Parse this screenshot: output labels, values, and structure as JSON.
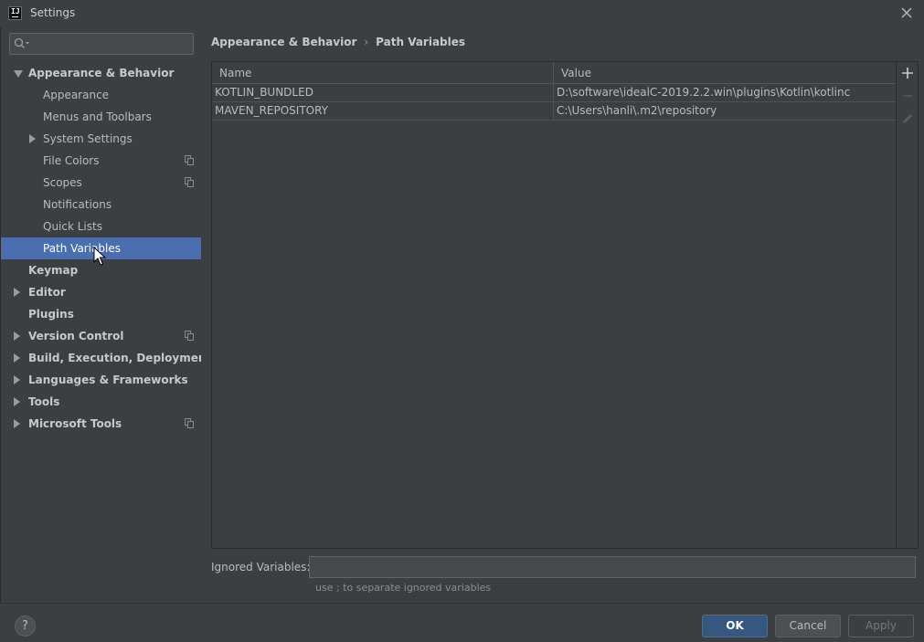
{
  "window": {
    "title": "Settings",
    "app_icon_text": "IJ"
  },
  "sidebar": {
    "search_placeholder": "",
    "items": [
      {
        "label": "Appearance & Behavior",
        "bold": true,
        "arrow": "down"
      },
      {
        "label": "Appearance"
      },
      {
        "label": "Menus and Toolbars"
      },
      {
        "label": "System Settings",
        "arrow": "right"
      },
      {
        "label": "File Colors",
        "project_icon": true
      },
      {
        "label": "Scopes",
        "project_icon": true
      },
      {
        "label": "Notifications"
      },
      {
        "label": "Quick Lists"
      },
      {
        "label": "Path Variables",
        "selected": true
      },
      {
        "label": "Keymap",
        "bold": true
      },
      {
        "label": "Editor",
        "bold": true,
        "arrow": "right"
      },
      {
        "label": "Plugins",
        "bold": true
      },
      {
        "label": "Version Control",
        "bold": true,
        "arrow": "right",
        "project_icon": true
      },
      {
        "label": "Build, Execution, Deployment",
        "bold": true,
        "arrow": "right"
      },
      {
        "label": "Languages & Frameworks",
        "bold": true,
        "arrow": "right"
      },
      {
        "label": "Tools",
        "bold": true,
        "arrow": "right"
      },
      {
        "label": "Microsoft Tools",
        "bold": true,
        "arrow": "right",
        "project_icon": true
      }
    ]
  },
  "breadcrumb": {
    "parent": "Appearance & Behavior",
    "separator": "›",
    "current": "Path Variables"
  },
  "table": {
    "columns": [
      "Name",
      "Value"
    ],
    "rows": [
      {
        "name": "KOTLIN_BUNDLED",
        "value": "D:\\software\\idealC-2019.2.2.win\\plugins\\Kotlin\\kotlinc"
      },
      {
        "name": "MAVEN_REPOSITORY",
        "value": "C:\\Users\\hanli\\.m2\\repository"
      }
    ]
  },
  "toolbar": {
    "add_icon": "plus-icon",
    "remove_icon": "minus-icon",
    "edit_icon": "pencil-icon"
  },
  "ignored": {
    "label": "Ignored Variables:",
    "value": "",
    "hint": "use ; to separate ignored variables"
  },
  "footer": {
    "help": "?",
    "ok": "OK",
    "cancel": "Cancel",
    "apply": "Apply"
  },
  "colors": {
    "selection": "#4b6eaf",
    "background": "#3c3f41",
    "ok_button": "#365880"
  }
}
